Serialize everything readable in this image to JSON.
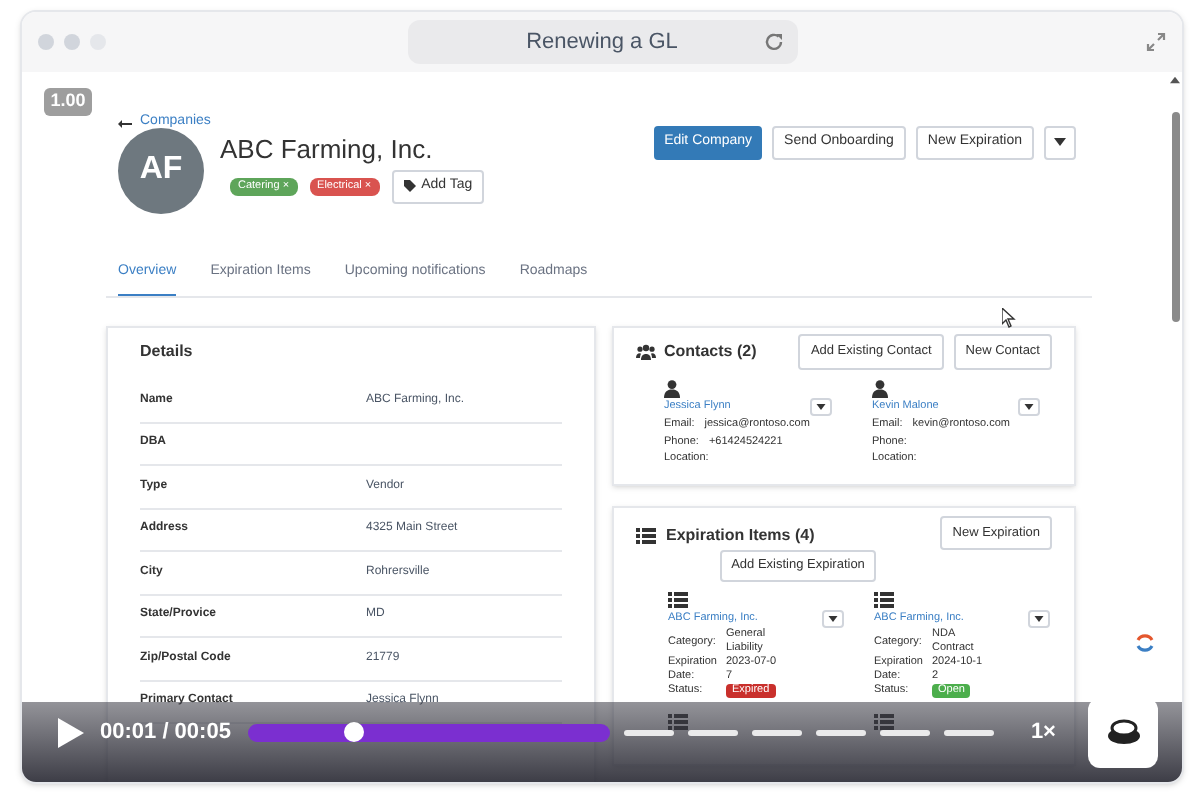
{
  "window": {
    "title": "Renewing a GL"
  },
  "zoom_badge": "1.00",
  "back_link": "Companies",
  "company": {
    "initials": "AF",
    "name": "ABC Farming, Inc.",
    "tags": [
      {
        "label": "Catering",
        "color": "#5ea55a"
      },
      {
        "label": "Electrical",
        "color": "#d9534f"
      }
    ],
    "add_tag": "Add Tag",
    "remove_mark": "×"
  },
  "actions": [
    {
      "label": "Edit Company",
      "kind": "primary"
    },
    {
      "label": "Send Onboarding",
      "kind": "default"
    },
    {
      "label": "New Expiration",
      "kind": "default"
    }
  ],
  "tabs": [
    {
      "label": "Overview",
      "selected": true
    },
    {
      "label": "Expiration Items",
      "selected": false
    },
    {
      "label": "Upcoming notifications",
      "selected": false
    },
    {
      "label": "Roadmaps",
      "selected": false
    }
  ],
  "details": {
    "title": "Details",
    "rows": [
      {
        "label": "Name",
        "value": "ABC Farming, Inc."
      },
      {
        "label": "DBA"
      },
      {
        "label": "Type",
        "value": "Vendor"
      },
      {
        "label": "Address",
        "value": "4325 Main Street"
      },
      {
        "label": "City",
        "value": "Rohrersville"
      },
      {
        "label": "State/Provice",
        "value": "MD"
      },
      {
        "label": "Zip/Postal Code",
        "value": "21779"
      },
      {
        "label": "Primary Contact",
        "value": "Jessica Flynn"
      }
    ]
  },
  "contacts": {
    "title": "Contacts (2)",
    "buttons": [
      "Add Existing Contact",
      "New Contact"
    ],
    "items": [
      {
        "name": "Jessica Flynn",
        "fields": [
          {
            "label": "Email:",
            "value": "jessica@rontoso.com"
          },
          {
            "label": "Phone:",
            "value": "+61424524221"
          },
          {
            "label": "Location:"
          }
        ]
      },
      {
        "name": "Kevin Malone",
        "fields": [
          {
            "label": "Email:",
            "value": "kevin@rontoso.com"
          },
          {
            "label": "Phone:"
          },
          {
            "label": "Location:"
          }
        ]
      }
    ]
  },
  "expirations": {
    "title": "Expiration Items (4)",
    "new_button": "New Expiration",
    "add_button": "Add Existing Expiration",
    "items": [
      {
        "kind": "full",
        "name": "ABC Farming, Inc.",
        "category_label": "Category:",
        "category": "General Liability",
        "date_label": "Expiration Date:",
        "date": "2023-07-07",
        "status_label": "Status:",
        "status": "Expired",
        "color": "#c9302c"
      },
      {
        "kind": "full",
        "name": "ABC Farming, Inc.",
        "category_label": "Category:",
        "category": "NDA Contract",
        "date_label": "Expiration Date:",
        "date": "2024-10-12",
        "status_label": "Status:",
        "status": "Open",
        "color": "#4cae4c"
      },
      {
        "kind": "cut"
      },
      {
        "kind": "cut"
      }
    ]
  },
  "player": {
    "time": "00:01 / 00:05",
    "level": 0.14,
    "speed": "1×",
    "chapters": [
      {
        "selected": true
      },
      {
        "selected": false
      },
      {
        "selected": false
      },
      {
        "selected": false
      },
      {
        "selected": false
      },
      {
        "selected": false
      },
      {
        "selected": false
      }
    ]
  }
}
